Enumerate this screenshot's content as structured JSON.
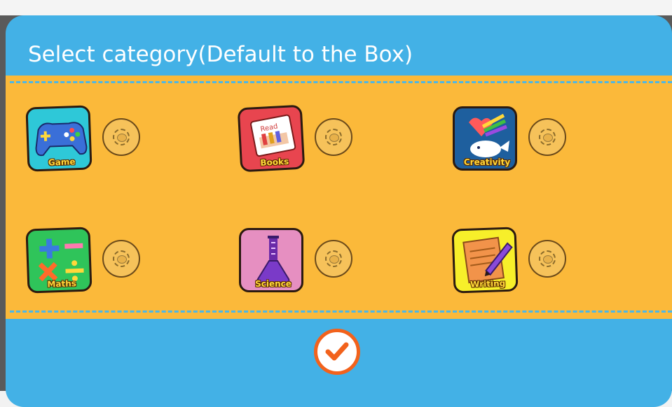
{
  "dialog": {
    "title": "Select category(Default to the Box)"
  },
  "categories": [
    {
      "label": "Game",
      "icon": "gamepad-icon",
      "color": "#2ec8d8"
    },
    {
      "label": "Books",
      "icon": "book-icon",
      "color": "#e8454f"
    },
    {
      "label": "Creativity",
      "icon": "creativity-icon",
      "color": "#1e5f9e"
    },
    {
      "label": "Maths",
      "icon": "maths-icon",
      "color": "#2fc45a"
    },
    {
      "label": "Science",
      "icon": "science-icon",
      "color": "#e68fc1"
    },
    {
      "label": "Writing",
      "icon": "writing-icon",
      "color": "#f7ef2a"
    }
  ],
  "confirm": {
    "icon": "checkmark-icon"
  },
  "colors": {
    "dialog_bg": "#43b1e6",
    "panel_bg": "#fbb93a",
    "confirm_ring": "#f2621c"
  }
}
